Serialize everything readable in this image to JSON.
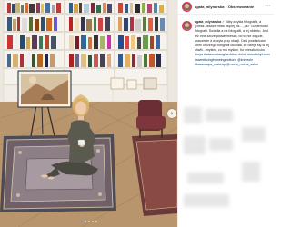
{
  "post": {
    "username": "agata_mlynarska",
    "separator": "•",
    "follow_label": "Obserwowanie",
    "more_icon": "ellipsis-icon",
    "caption": {
      "user": "agata_mlynarska",
      "verified_icon": "verified-badge-icon",
      "body": "Niby zwykła fotografia, a jednak zawsze mówi więcej niż... „ulu” i czytelności fotografii. Świadła a na fotografii, a jej obiektu. Jest też inne szczegółowe miesac, bo to nie zdjęcie, znaczenie a wszyta przy okazji. Dziś poddańcam ułom uroczego fotografii Michała, że dzieje się w tej chwili... myśleć, co ma myśleć, for mieszkańców.",
      "tags": "#ruya #adamo #awg/ca #dom #etek #studiobyfroom #sweetlivingfromeingmotions @krzyzoln #kaszuzapa_makeup @mono_mohai_salon"
    },
    "carousel": {
      "next_icon": "chevron-right-icon",
      "total_slides": 5,
      "active_slide": 1,
      "accent": "#4aa3ff"
    },
    "colors": {
      "link": "#00376b",
      "text": "#262626",
      "ring": "#e1306c"
    }
  }
}
